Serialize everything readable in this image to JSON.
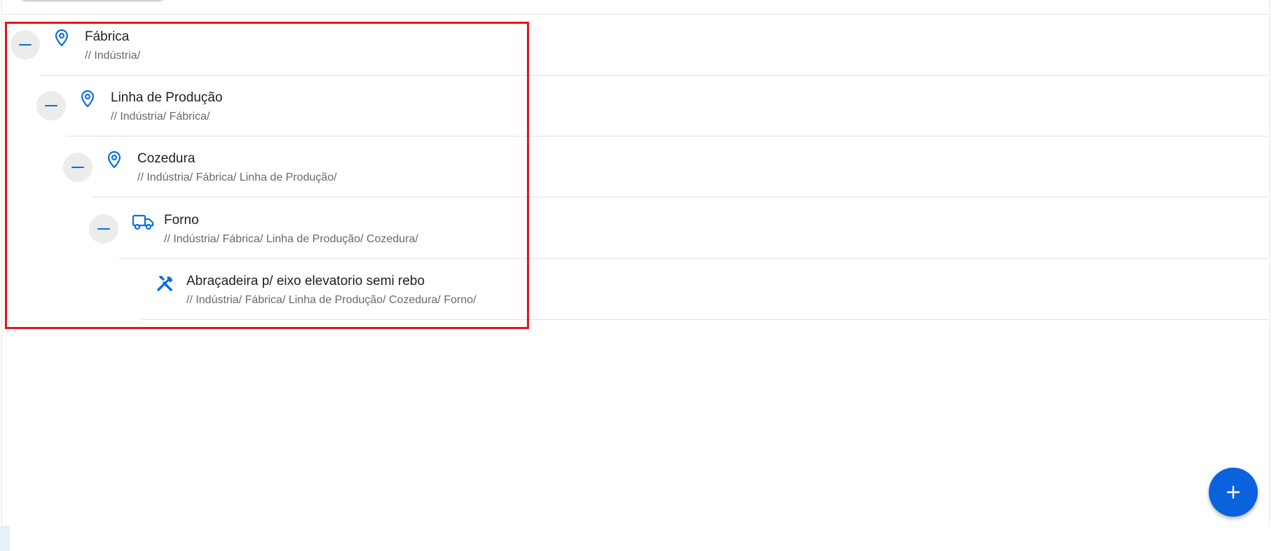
{
  "tree": {
    "nodes": [
      {
        "title": "Fábrica",
        "path": "// Indústria/",
        "icon": "map-pin-icon",
        "expanded": true
      },
      {
        "title": "Linha de Produção",
        "path": "// Indústria/ Fábrica/",
        "icon": "map-pin-icon",
        "expanded": true
      },
      {
        "title": "Cozedura",
        "path": "// Indústria/ Fábrica/ Linha de Produção/",
        "icon": "map-pin-icon",
        "expanded": true
      },
      {
        "title": "Forno",
        "path": "// Indústria/ Fábrica/ Linha de Produção/ Cozedura/",
        "icon": "truck-icon",
        "expanded": true
      },
      {
        "title": "Abraçadeira p/ eixo elevatorio semi rebo",
        "path": "// Indústria/ Fábrica/ Linha de Produção/ Cozedura/ Forno/",
        "icon": "tools-icon",
        "expanded": false
      }
    ]
  },
  "fab": {
    "icon": "plus-icon"
  },
  "colors": {
    "accent": "#0a6fe0",
    "fab": "#0a63dd",
    "highlight": "#e8121b",
    "collapse_bg": "#ececec"
  }
}
